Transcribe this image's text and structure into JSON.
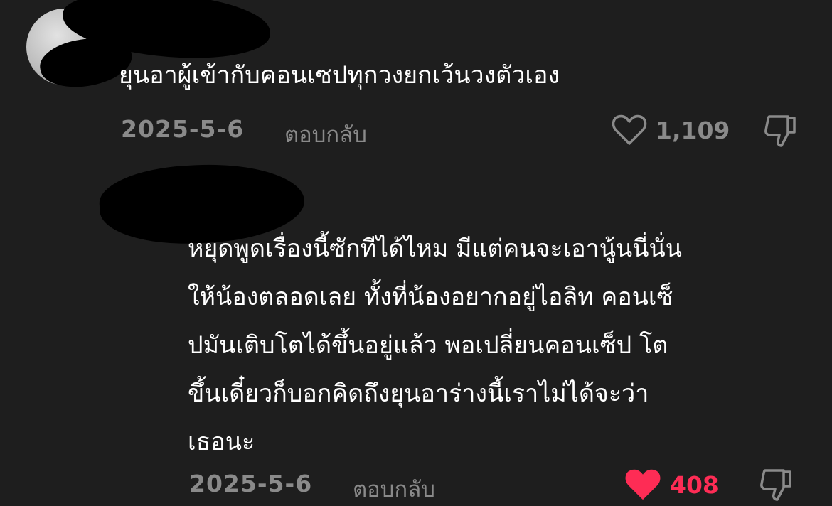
{
  "comments": [
    {
      "text": "ยุนอาผู้เข้ากับคอนเซปทุกวงยกเว้นวงตัวเอง",
      "date": "2025-5-6",
      "reply_label": "ตอบกลับ",
      "likes": "1,109",
      "liked": false
    },
    {
      "text": "หยุดพูดเรื่องนี้ซักทีได้ไหม มีแต่คนจะเอานู้นนี่นั่น\nให้น้องตลอดเลย ทั้งที่น้องอยากอยู่ไอลิท คอนเซ็\nปมันเติบโตได้ขึ้นอยู่แล้ว พอเปลี่ยนคอนเซ็ป โต\nขึ้นเดี๋ยวก็บอกคิดถึงยุนอาร่างนี้เราไม่ได้จะว่า\nเธอนะ",
      "date": "2025-5-6",
      "reply_label": "ตอบกลับ",
      "likes": "408",
      "liked": true
    }
  ],
  "icons": {
    "like": "heart-icon",
    "dislike": "thumbs-down-icon"
  },
  "colors": {
    "background": "#1e1e1e",
    "text": "#ffffff",
    "muted": "#8a8a8a",
    "liked": "#fe2c55"
  }
}
